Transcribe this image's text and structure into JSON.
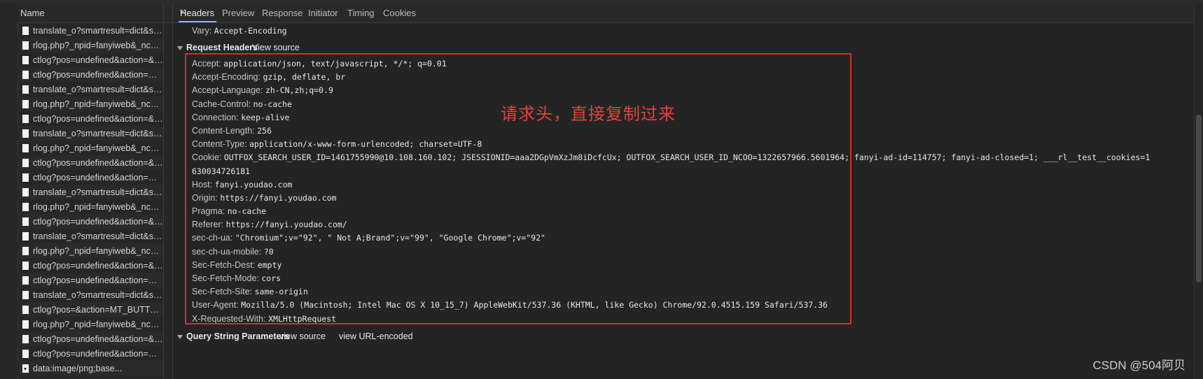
{
  "name_column": {
    "header": "Name"
  },
  "requests": [
    {
      "label": "translate_o?smartresult=dict&sm...",
      "icon": "document-icon"
    },
    {
      "label": "rlog.php?_npid=fanyiweb&_ncat=...",
      "icon": "document-icon"
    },
    {
      "label": "ctlog?pos=undefined&action=&se...",
      "icon": "document-icon"
    },
    {
      "label": "ctlog?pos=undefined&action=RE...",
      "icon": "document-icon"
    },
    {
      "label": "translate_o?smartresult=dict&sm...",
      "icon": "document-icon"
    },
    {
      "label": "rlog.php?_npid=fanyiweb&_ncat=...",
      "icon": "document-icon"
    },
    {
      "label": "ctlog?pos=undefined&action=&se...",
      "icon": "document-icon"
    },
    {
      "label": "translate_o?smartresult=dict&sm...",
      "icon": "document-icon"
    },
    {
      "label": "rlog.php?_npid=fanyiweb&_ncat=...",
      "icon": "document-icon"
    },
    {
      "label": "ctlog?pos=undefined&action=&se...",
      "icon": "document-icon"
    },
    {
      "label": "ctlog?pos=undefined&action=RE...",
      "icon": "document-icon"
    },
    {
      "label": "translate_o?smartresult=dict&sm...",
      "icon": "document-icon"
    },
    {
      "label": "rlog.php?_npid=fanyiweb&_ncat=...",
      "icon": "document-icon"
    },
    {
      "label": "ctlog?pos=undefined&action=&se...",
      "icon": "document-icon"
    },
    {
      "label": "translate_o?smartresult=dict&sm...",
      "icon": "document-icon"
    },
    {
      "label": "rlog.php?_npid=fanyiweb&_ncat=...",
      "icon": "document-icon"
    },
    {
      "label": "ctlog?pos=undefined&action=&se...",
      "icon": "document-icon"
    },
    {
      "label": "ctlog?pos=undefined&action=RE...",
      "icon": "document-icon"
    },
    {
      "label": "translate_o?smartresult=dict&sm...",
      "icon": "document-icon"
    },
    {
      "label": "ctlog?pos=&action=MT_BUTTON...",
      "icon": "document-icon"
    },
    {
      "label": "rlog.php?_npid=fanyiweb&_ncat=...",
      "icon": "document-icon"
    },
    {
      "label": "ctlog?pos=undefined&action=&se...",
      "icon": "document-icon"
    },
    {
      "label": "ctlog?pos=undefined&action=RE...",
      "icon": "document-icon"
    },
    {
      "label": "data:image/png;base...",
      "icon": "image-file-icon"
    }
  ],
  "tabs": [
    "Headers",
    "Preview",
    "Response",
    "Initiator",
    "Timing",
    "Cookies"
  ],
  "active_tab": "Headers",
  "vary": {
    "key": "Vary:",
    "value": "Accept-Encoding"
  },
  "request_headers": {
    "title": "Request Headers",
    "view_source": "View source",
    "rows": [
      {
        "key": "Accept:",
        "value": "application/json, text/javascript, */*; q=0.01"
      },
      {
        "key": "Accept-Encoding:",
        "value": "gzip, deflate, br"
      },
      {
        "key": "Accept-Language:",
        "value": "zh-CN,zh;q=0.9"
      },
      {
        "key": "Cache-Control:",
        "value": "no-cache"
      },
      {
        "key": "Connection:",
        "value": "keep-alive"
      },
      {
        "key": "Content-Length:",
        "value": "256"
      },
      {
        "key": "Content-Type:",
        "value": "application/x-www-form-urlencoded; charset=UTF-8"
      }
    ],
    "cookie": {
      "key": "Cookie:",
      "value": "OUTFOX_SEARCH_USER_ID=1461755990@10.108.160.102; JSESSIONID=aaa2DGpVmXzJm8iDcfcUx; OUTFOX_SEARCH_USER_ID_NCOO=1322657966.5601964; fanyi-ad-id=114757; fanyi-ad-closed=1; ___rl__test__cookies=1",
      "continuation": "630034726181"
    },
    "rows_after": [
      {
        "key": "Host:",
        "value": "fanyi.youdao.com"
      },
      {
        "key": "Origin:",
        "value": "https://fanyi.youdao.com"
      },
      {
        "key": "Pragma:",
        "value": "no-cache"
      },
      {
        "key": "Referer:",
        "value": "https://fanyi.youdao.com/"
      },
      {
        "key": "sec-ch-ua:",
        "value": "\"Chromium\";v=\"92\", \" Not A;Brand\";v=\"99\", \"Google Chrome\";v=\"92\""
      },
      {
        "key": "sec-ch-ua-mobile:",
        "value": "?0"
      },
      {
        "key": "Sec-Fetch-Dest:",
        "value": "empty"
      },
      {
        "key": "Sec-Fetch-Mode:",
        "value": "cors"
      },
      {
        "key": "Sec-Fetch-Site:",
        "value": "same-origin"
      },
      {
        "key": "User-Agent:",
        "value": "Mozilla/5.0 (Macintosh; Intel Mac OS X 10_15_7) AppleWebKit/537.36 (KHTML, like Gecko) Chrome/92.0.4515.159 Safari/537.36"
      },
      {
        "key": "X-Requested-With:",
        "value": "XMLHttpRequest"
      }
    ]
  },
  "query_string": {
    "title": "Query String Parameters",
    "view_source": "view source",
    "view_url_encoded": "view URL-encoded"
  },
  "annotation": "请求头，直接复制过来",
  "watermark": "CSDN @504阿贝",
  "colors": {
    "annotation_red": "#d0302a",
    "active_tab_underline": "#8ab4f8"
  }
}
